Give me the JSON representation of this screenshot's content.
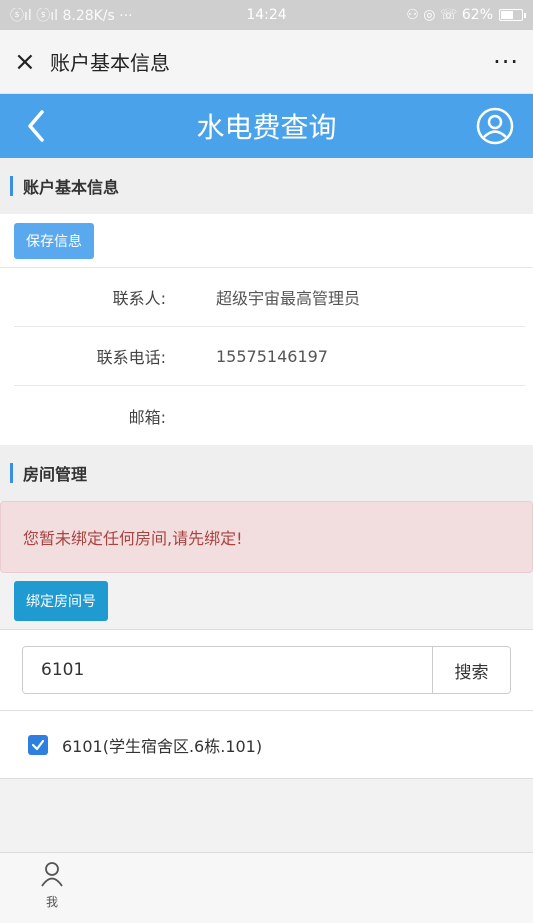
{
  "status": {
    "signal": "ⓢıl ⓢıl 8.28K/s ···",
    "time": "14:24",
    "right": "⚇ ◎ ☏ 62%",
    "battery_level": 0.62
  },
  "wechat": {
    "title": "账户基本信息",
    "close": "×",
    "more": "···"
  },
  "appbar": {
    "title": "水电费查询"
  },
  "account": {
    "section_title": "账户基本信息",
    "save_button": "保存信息",
    "rows": [
      {
        "label": "联系人:",
        "value": "超级宇宙最高管理员"
      },
      {
        "label": "联系电话:",
        "value": "15575146197"
      },
      {
        "label": "邮箱:",
        "value": ""
      }
    ]
  },
  "room": {
    "section_title": "房间管理",
    "alert": "您暂未绑定任何房间,请先绑定!",
    "bind_button": "绑定房间号",
    "search_value": "6101",
    "search_button": "搜索",
    "result": "6101(学生宿舍区.6栋.101)",
    "result_checked": true
  },
  "tabbar": {
    "me_label": "我"
  }
}
